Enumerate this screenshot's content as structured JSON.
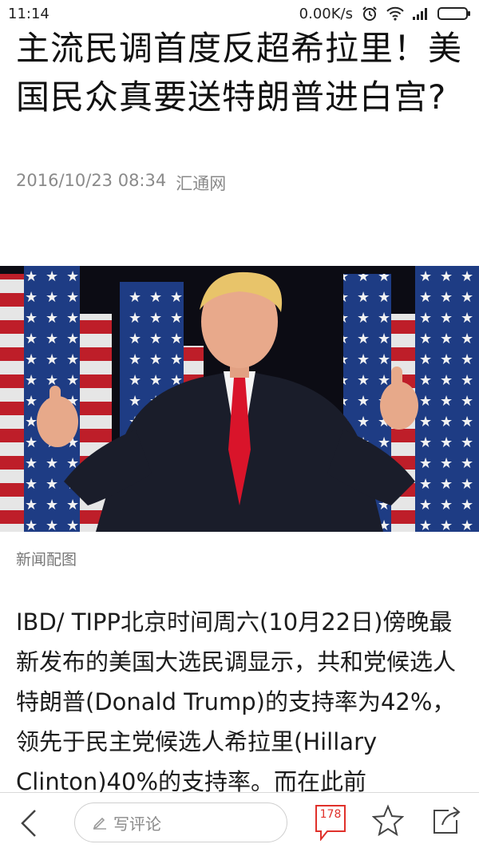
{
  "status_bar": {
    "time": "11:14",
    "network_speed": "0.00K/s",
    "icons": [
      "alarm-icon",
      "wifi-icon",
      "signal-icon",
      "battery-icon"
    ]
  },
  "article": {
    "title": "主流民调首度反超希拉里！美国民众真要送特朗普进白宫?",
    "datetime": "2016/10/23 08:34",
    "source": "汇通网",
    "image_caption": "新闻配图",
    "body": "IBD/ TIPP北京时间周六(10月22日)傍晚最新发布的美国大选民调显示，共和党候选人特朗普(Donald Trump)的支持率为42%，领先于民主党候选人希拉里(Hillary Clinton)40%的支持率。而在此前"
  },
  "toolbar": {
    "comment_placeholder": "写评论",
    "comment_count": "178",
    "icons": [
      "back-icon",
      "pen-icon",
      "comment-count-icon",
      "star-icon",
      "share-icon"
    ]
  },
  "colors": {
    "accent": "#e0312b",
    "meta_text": "#8a8a8a"
  }
}
